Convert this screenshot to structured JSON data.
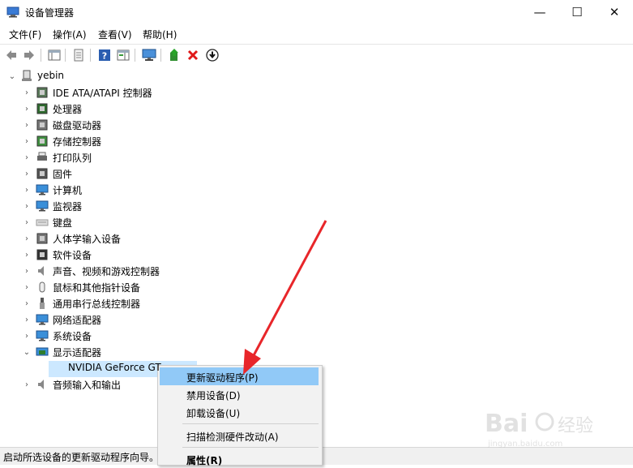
{
  "window": {
    "title": "设备管理器",
    "minimize": "—",
    "maximize": "☐",
    "close": "✕"
  },
  "menu": {
    "items": [
      "文件(F)",
      "操作(A)",
      "查看(V)",
      "帮助(H)"
    ]
  },
  "tree": {
    "root": "yebin",
    "items": [
      {
        "label": "IDE ATA/ATAPI 控制器",
        "icon": "ide-controller-icon"
      },
      {
        "label": "处理器",
        "icon": "processor-icon"
      },
      {
        "label": "磁盘驱动器",
        "icon": "disk-drive-icon"
      },
      {
        "label": "存储控制器",
        "icon": "storage-controller-icon"
      },
      {
        "label": "打印队列",
        "icon": "printer-icon"
      },
      {
        "label": "固件",
        "icon": "firmware-icon"
      },
      {
        "label": "计算机",
        "icon": "computer-icon"
      },
      {
        "label": "监视器",
        "icon": "monitor-icon"
      },
      {
        "label": "键盘",
        "icon": "keyboard-icon"
      },
      {
        "label": "人体学输入设备",
        "icon": "hid-icon"
      },
      {
        "label": "软件设备",
        "icon": "software-device-icon"
      },
      {
        "label": "声音、视频和游戏控制器",
        "icon": "sound-icon"
      },
      {
        "label": "鼠标和其他指针设备",
        "icon": "mouse-icon"
      },
      {
        "label": "通用串行总线控制器",
        "icon": "usb-icon"
      },
      {
        "label": "网络适配器",
        "icon": "network-adapter-icon"
      },
      {
        "label": "系统设备",
        "icon": "system-device-icon"
      },
      {
        "label": "显示适配器",
        "icon": "display-adapter-icon"
      },
      {
        "label": "NVIDIA GeForce GT",
        "icon": "gpu-icon"
      },
      {
        "label": "音频输入和输出",
        "icon": "audio-io-icon"
      }
    ]
  },
  "context_menu": {
    "items": [
      "更新驱动程序(P)",
      "禁用设备(D)",
      "卸载设备(U)",
      "扫描检测硬件改动(A)",
      "属性(R)"
    ]
  },
  "status": {
    "text": "启动所选设备的更新驱动程序向导。"
  },
  "watermark": {
    "brand": "Bai",
    "brand2": "经验",
    "url": "jingyan.baidu.com"
  },
  "colors": {
    "selection": "#cce8ff",
    "context_highlight": "#91c9f7",
    "arrow": "#e8262a"
  }
}
